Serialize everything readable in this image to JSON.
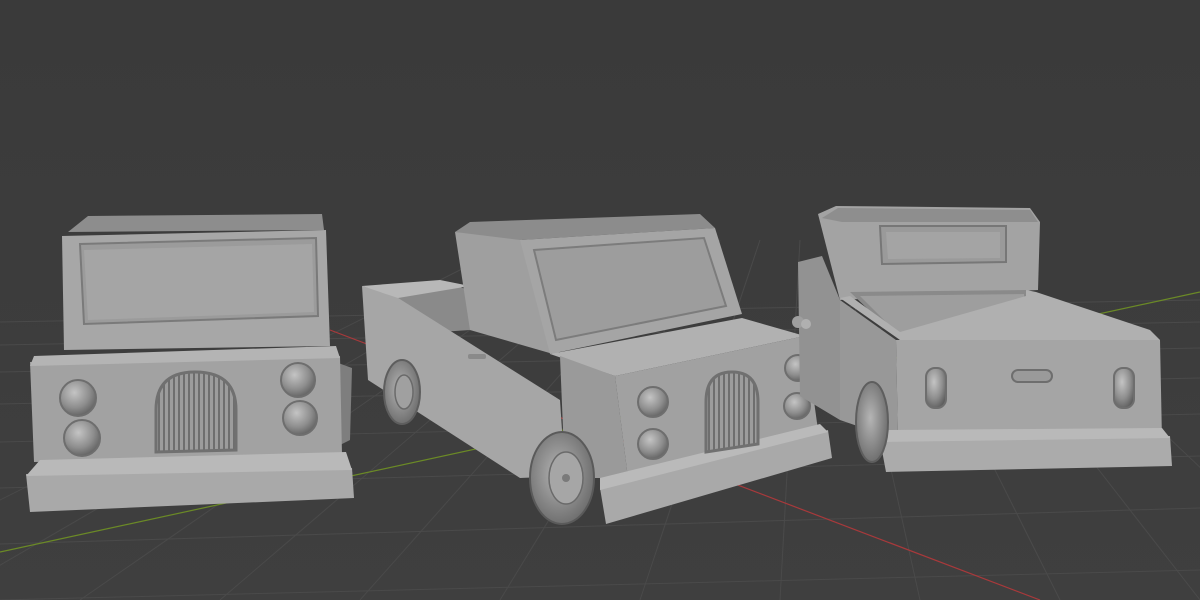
{
  "viewport": {
    "background": "#3d3d3d",
    "grid_color": "#4a4a4a",
    "x_axis_color": "#a8393b",
    "y_axis_color": "#6b8a26"
  },
  "scene": {
    "objects": [
      {
        "name": "pickup-truck-front-view",
        "view": "front"
      },
      {
        "name": "pickup-truck-three-quarter-view",
        "view": "three-quarter"
      },
      {
        "name": "pickup-truck-rear-view",
        "view": "rear"
      }
    ],
    "material_color": "#9a9a9a"
  }
}
